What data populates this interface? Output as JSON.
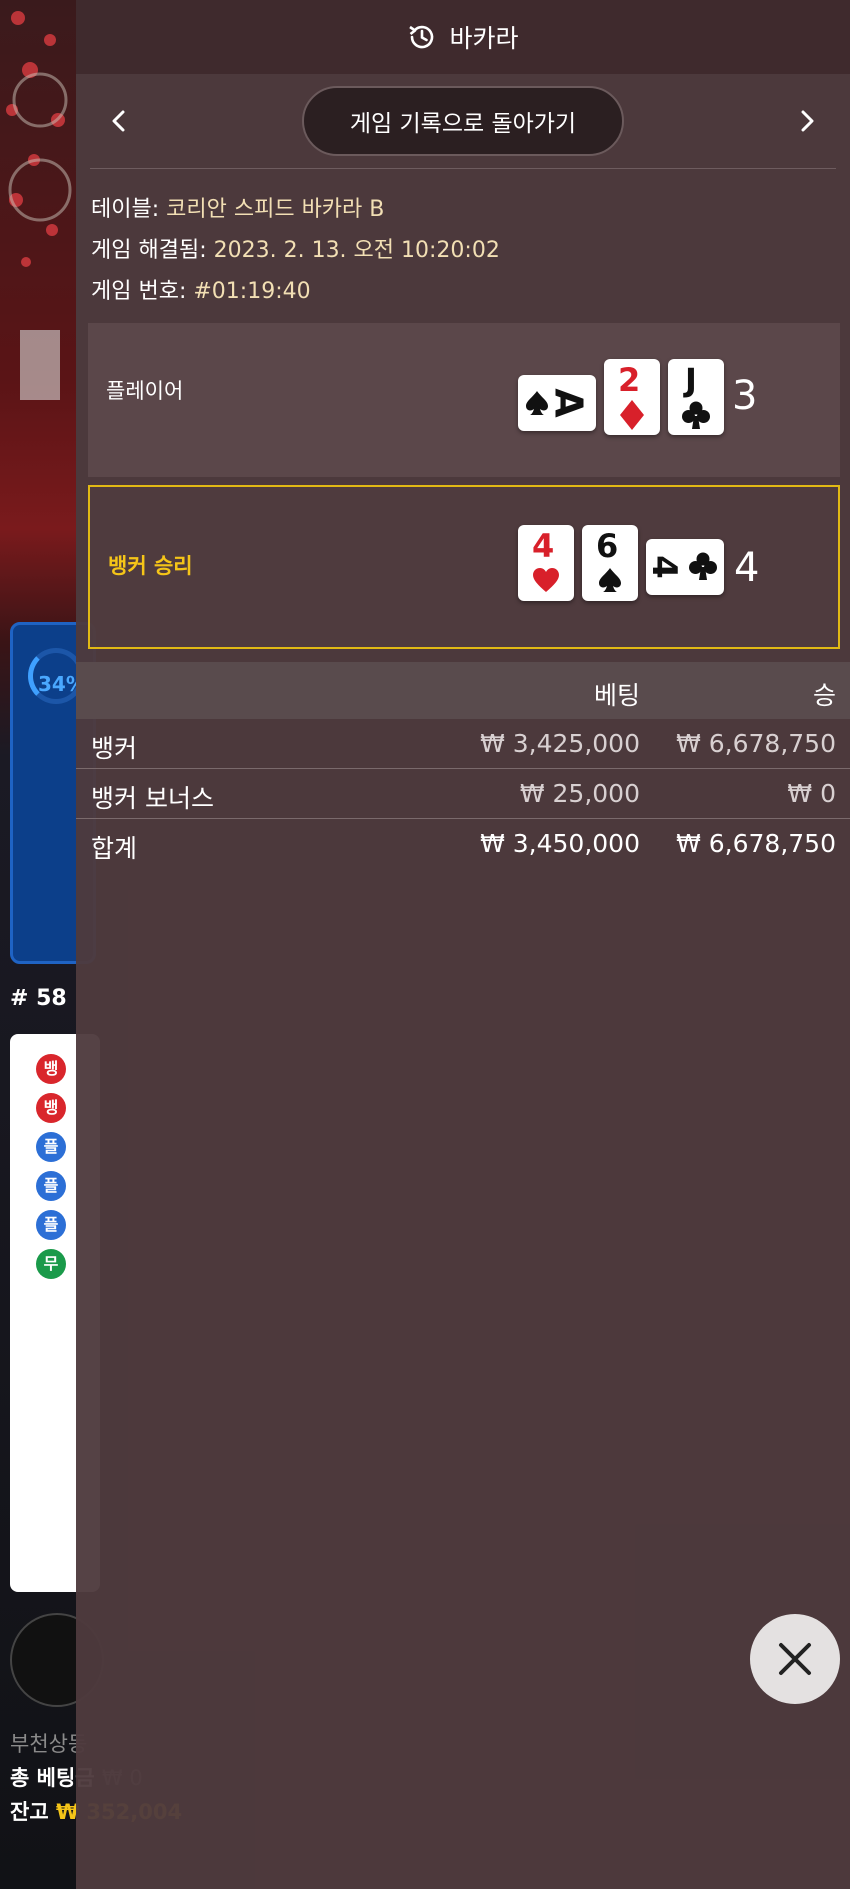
{
  "header": {
    "title": "바카라",
    "back_button_label": "게임 기록으로 돌아가기"
  },
  "game_info": {
    "table_label": "테이블:",
    "table_value": "코리안 스피드 바카라 B",
    "resolved_label": "게임 해결됨:",
    "resolved_value": "2023. 2. 13. 오전 10:20:02",
    "number_label": "게임 번호:",
    "number_value": "#01:19:40"
  },
  "hands": {
    "player": {
      "label": "플레이어",
      "score": "3",
      "cards": [
        {
          "rank": "A",
          "suit": "spade",
          "color": "#111111",
          "orientation": "sideways"
        },
        {
          "rank": "2",
          "suit": "diamond",
          "color": "#d8202a",
          "orientation": "upright"
        },
        {
          "rank": "J",
          "suit": "club",
          "color": "#111111",
          "orientation": "upright"
        }
      ]
    },
    "banker": {
      "label": "뱅커 승리",
      "score": "4",
      "cards": [
        {
          "rank": "4",
          "suit": "heart",
          "color": "#d8202a",
          "orientation": "upright"
        },
        {
          "rank": "6",
          "suit": "spade",
          "color": "#111111",
          "orientation": "upright"
        },
        {
          "rank": "4",
          "suit": "club",
          "color": "#111111",
          "orientation": "sideways"
        }
      ]
    }
  },
  "bets": {
    "header_bet": "베팅",
    "header_win": "승",
    "rows": [
      {
        "name": "뱅커",
        "bet": "₩ 3,425,000",
        "win": "₩ 6,678,750"
      },
      {
        "name": "뱅커 보너스",
        "bet": "₩ 25,000",
        "win": "₩ 0"
      }
    ],
    "total": {
      "name": "합계",
      "bet": "₩ 3,450,000",
      "win": "₩ 6,678,750"
    }
  },
  "background": {
    "percent": "34%",
    "shoe_number": "# 58",
    "bead_road": [
      "뱅",
      "뱅",
      "플",
      "플",
      "플",
      "무"
    ],
    "footer_name": "부천상동",
    "footer_total_bet_label": "총 베팅금",
    "footer_total_bet_value": "₩ 0",
    "footer_balance_label": "잔고",
    "footer_balance_value": "₩ 352,004"
  },
  "colors": {
    "accent_gold": "#f5c518",
    "card_red": "#d8202a",
    "overlay": "#4e3a3d",
    "banker_border": "#e1b914"
  },
  "icons": [
    "history-icon",
    "chevron-left-icon",
    "chevron-right-icon",
    "close-icon"
  ]
}
